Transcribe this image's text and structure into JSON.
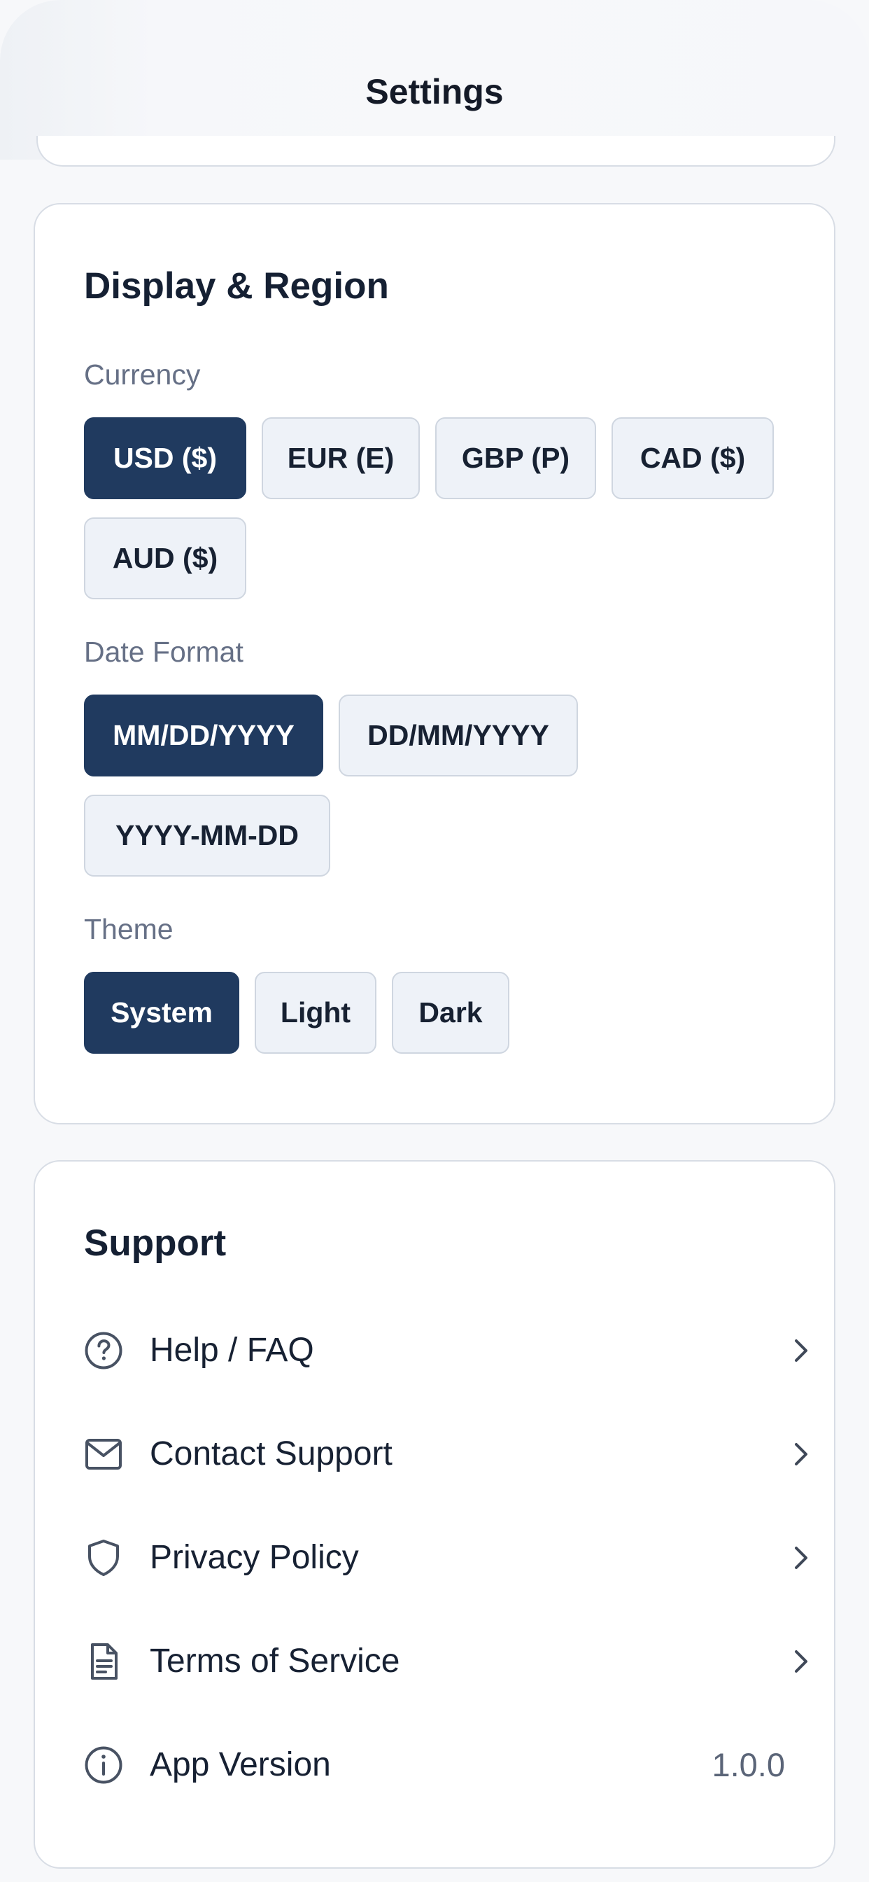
{
  "header": {
    "title": "Settings"
  },
  "display_region": {
    "title": "Display & Region",
    "currency": {
      "label": "Currency",
      "options": [
        "USD ($)",
        "EUR (E)",
        "GBP (P)",
        "CAD ($)",
        "AUD ($)"
      ],
      "selected": "USD ($)"
    },
    "date_format": {
      "label": "Date Format",
      "options": [
        "MM/DD/YYYY",
        "DD/MM/YYYY",
        "YYYY-MM-DD"
      ],
      "selected": "MM/DD/YYYY"
    },
    "theme": {
      "label": "Theme",
      "options": [
        "System",
        "Light",
        "Dark"
      ],
      "selected": "System"
    }
  },
  "support": {
    "title": "Support",
    "items": [
      {
        "label": "Help / FAQ",
        "icon": "help-circle-icon"
      },
      {
        "label": "Contact Support",
        "icon": "mail-icon"
      },
      {
        "label": "Privacy Policy",
        "icon": "shield-icon"
      },
      {
        "label": "Terms of Service",
        "icon": "document-icon"
      },
      {
        "label": "App Version",
        "icon": "info-icon",
        "value": "1.0.0"
      }
    ]
  },
  "colors": {
    "accent": "#203a5f",
    "chip_background": "#eef2f8",
    "page_background": "#f7f8fa"
  }
}
